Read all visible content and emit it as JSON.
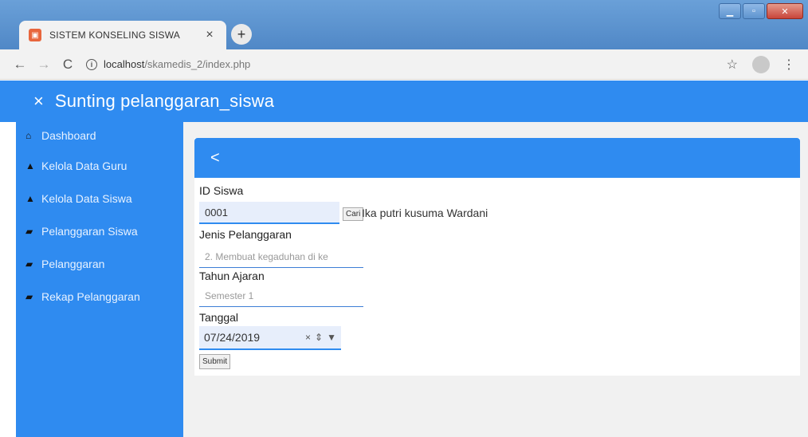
{
  "browser": {
    "tab_title": "SISTEM KONSELING SISWA",
    "tab_close": "×",
    "new_tab": "+",
    "url_host": "localhost",
    "url_path": "/skamedis_2/index.php"
  },
  "appbar": {
    "close_symbol": "×",
    "title": "Sunting pelanggaran_siswa"
  },
  "sidebar": {
    "items": [
      {
        "label": "Dashboard",
        "icon": "home-icon"
      },
      {
        "label": "Kelola Data Guru",
        "icon": "user-icon"
      },
      {
        "label": "Kelola Data Siswa",
        "icon": "user-icon"
      },
      {
        "label": "Pelanggaran Siswa",
        "icon": "book-icon"
      },
      {
        "label": "Pelanggaran",
        "icon": "book-icon"
      },
      {
        "label": "Rekap Pelanggaran",
        "icon": "book-icon"
      }
    ]
  },
  "form": {
    "back_symbol": "<",
    "id_siswa_label": "ID Siswa",
    "id_siswa_value": "0001",
    "cari_label": "Cari",
    "student_name": "Ika putri kusuma Wardani",
    "jenis_label": "Jenis Pelanggaran",
    "jenis_value": "2. Membuat kegaduhan di ke",
    "tahun_label": "Tahun Ajaran",
    "tahun_value": "Semester 1",
    "tanggal_label": "Tanggal",
    "tanggal_value": "07/24/2019",
    "submit_label": "Submit"
  },
  "colors": {
    "primary": "#2f8bf0",
    "input_bg": "#e7eefb"
  }
}
